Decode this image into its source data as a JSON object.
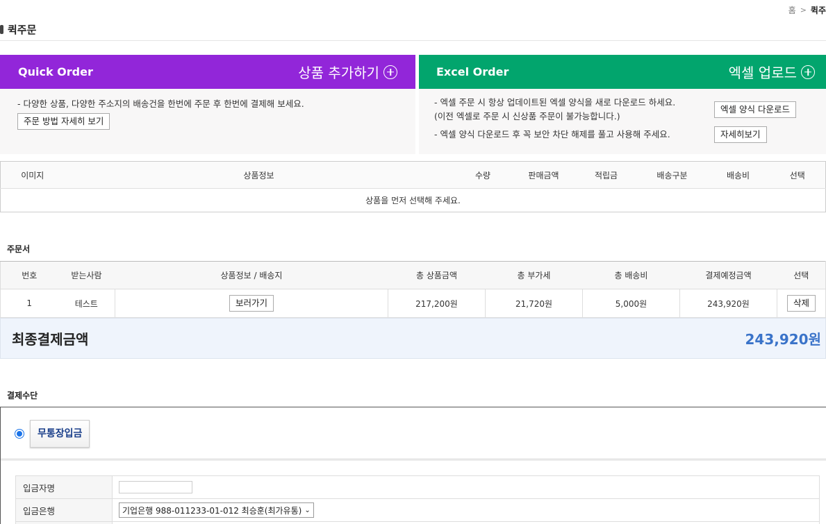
{
  "breadcrumb": {
    "home": "홈",
    "current": "퀵주"
  },
  "page_title": "퀵주문",
  "quick_panel": {
    "title": "Quick Order",
    "action": "상품 추가하기",
    "description": "- 다양한 상품, 다양한 주소지의 배송건을 한번에 주문 후 한번에 결제해 보세요.",
    "guide_button": "주문 방법 자세히 보기"
  },
  "excel_panel": {
    "title": "Excel Order",
    "action": "엑셀 업로드",
    "line1": "- 엑셀 주문 시 항상 업데이트된 엑셀 양식을 새로 다운로드 하세요.",
    "line2": "(이전 엑셀로 주문 시 신상품 주문이 불가능합니다.)",
    "line3": "- 엑셀 양식 다운로드 후 꼭 보안 차단 해제를 풀고 사용해 주세요.",
    "download_button": "엑셀 양식 다운로드",
    "detail_button": "자세히보기"
  },
  "product_table": {
    "headers": [
      "이미지",
      "상품정보",
      "수량",
      "판매금액",
      "적립금",
      "배송구분",
      "배송비",
      "선택"
    ],
    "empty_message": "상품을 먼저 선택해 주세요."
  },
  "order_section": {
    "label": "주문서",
    "headers": [
      "번호",
      "받는사람",
      "상품정보 / 배송지",
      "총 상품금액",
      "총 부가세",
      "총 배송비",
      "결제예정금액",
      "선택"
    ],
    "rows": [
      {
        "no": "1",
        "recipient": "테스트",
        "view_button": "보러가기",
        "total_product": "217,200원",
        "total_vat": "21,720원",
        "total_shipping": "5,000원",
        "expected": "243,920원",
        "delete_button": "삭제"
      }
    ]
  },
  "final": {
    "label": "최종결제금액",
    "value": "243,920원"
  },
  "payment": {
    "label": "결제수단",
    "method": "무통장입금",
    "depositor_label": "입금자명",
    "depositor_value": "",
    "bank_label": "입금은행",
    "bank_selected": "기업은행 988-011233-01-012 최승훈(최가유통)"
  },
  "colors": {
    "quick_purple": "#9226d9",
    "excel_green": "#02a56d",
    "final_blue": "#3a73c9"
  }
}
